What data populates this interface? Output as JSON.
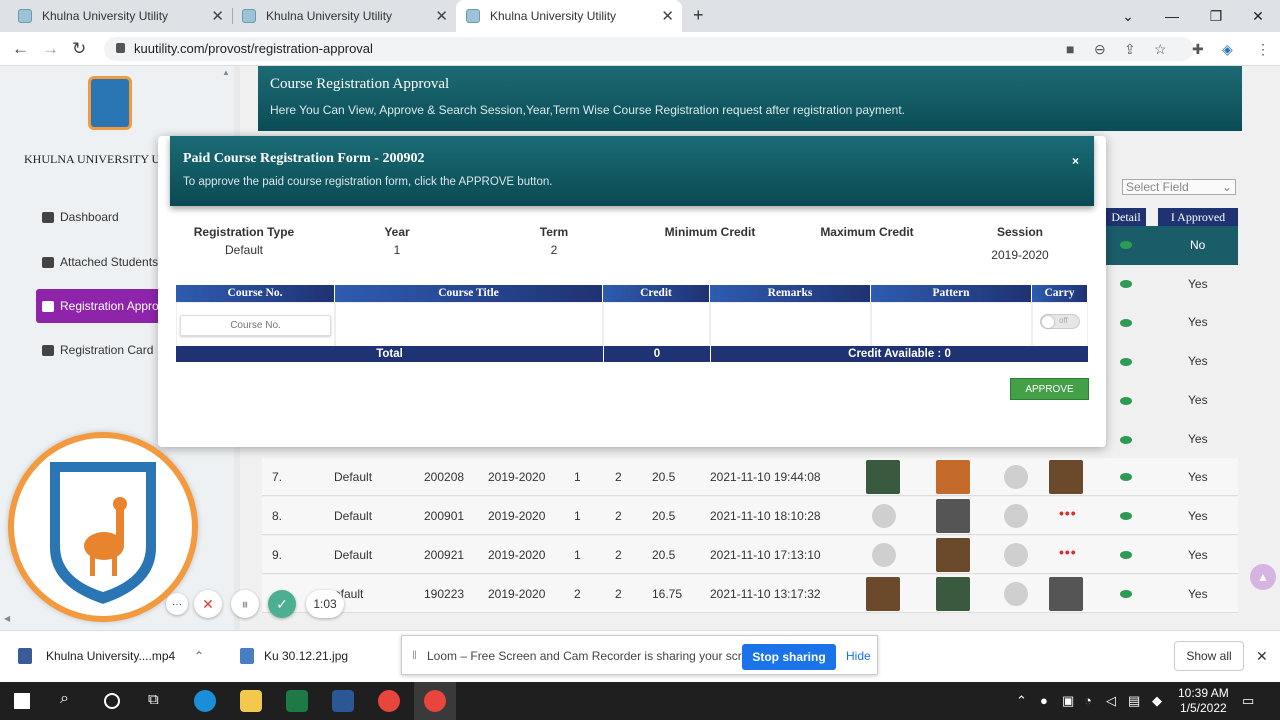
{
  "browser": {
    "tabs": [
      {
        "title": "Khulna University Utility"
      },
      {
        "title": "Khulna University Utility"
      },
      {
        "title": "Khulna University Utility"
      }
    ],
    "new_tab": "+",
    "url": "kuutility.com/provost/registration-approval"
  },
  "sidebar": {
    "site_name": "KHULNA UNIVERSITY UT",
    "items": [
      {
        "label": "Dashboard"
      },
      {
        "label": "Attached Students"
      },
      {
        "label": "Registration Appro"
      },
      {
        "label": "Registration Card"
      }
    ]
  },
  "header": {
    "title": "Course Registration Approval",
    "subtitle": "Here You Can View, Approve & Search Session,Year,Term Wise Course Registration request after registration payment."
  },
  "filter": {
    "select_field": "Select Field"
  },
  "table": {
    "col_detail": "Detail",
    "col_approved": "I Approved",
    "first_row_status": "No",
    "partial_statuses": [
      "Yes",
      "Yes",
      "Yes",
      "Yes",
      "Yes"
    ],
    "rows": [
      {
        "no": "7.",
        "type": "Default",
        "id": "200208",
        "session": "2019-2020",
        "year": "1",
        "term": "2",
        "credit": "20.5",
        "datetime": "2021-11-10 19:44:08",
        "approved": "Yes"
      },
      {
        "no": "8.",
        "type": "Default",
        "id": "200901",
        "session": "2019-2020",
        "year": "1",
        "term": "2",
        "credit": "20.5",
        "datetime": "2021-11-10 18:10:28",
        "approved": "Yes"
      },
      {
        "no": "9.",
        "type": "Default",
        "id": "200921",
        "session": "2019-2020",
        "year": "1",
        "term": "2",
        "credit": "20.5",
        "datetime": "2021-11-10 17:13:10",
        "approved": "Yes"
      },
      {
        "no": "",
        "type": "efault",
        "id": "190223",
        "session": "2019-2020",
        "year": "2",
        "term": "2",
        "credit": "16.75",
        "datetime": "2021-11-10 13:17:32",
        "approved": "Yes"
      }
    ]
  },
  "modal": {
    "title": "Paid Course Registration Form - 200902",
    "subtitle": "To approve the paid course registration form, click the APPROVE button.",
    "close": "×",
    "fields": [
      {
        "label": "Registration Type",
        "value": "Default"
      },
      {
        "label": "Year",
        "value": "1"
      },
      {
        "label": "Term",
        "value": "2"
      },
      {
        "label": "Minimum Credit",
        "value": ""
      },
      {
        "label": "Maximum Credit",
        "value": ""
      },
      {
        "label": "Session",
        "value": "2019-2020"
      }
    ],
    "columns": [
      "Course No.",
      "Course Title",
      "Credit",
      "Remarks",
      "Pattern",
      "Carry"
    ],
    "course_no_placeholder": "Course No.",
    "toggle_label": "off",
    "total_label": "Total",
    "total_credit": "0",
    "credit_available": "Credit Available : 0",
    "approve": "APPROVE"
  },
  "loom": {
    "timer": "1:03",
    "message": "Loom – Free Screen and Cam Recorder is sharing your screen.",
    "stop": "Stop sharing",
    "hide": "Hide"
  },
  "downloads": {
    "items": [
      {
        "name": "Khulna University....mp4"
      },
      {
        "name": "Ku 30.12.21.jpg"
      }
    ],
    "show_all": "Show all"
  },
  "taskbar": {
    "time": "10:39 AM",
    "date": "1/5/2022"
  }
}
